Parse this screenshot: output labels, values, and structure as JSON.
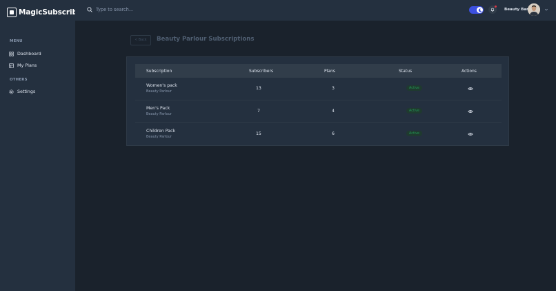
{
  "app": {
    "name": "MagicSubscribe",
    "logo_icon": "logo-square-icon"
  },
  "sidebar": {
    "groups": [
      {
        "title": "MENU",
        "items": [
          {
            "label": "Dashboard",
            "icon": "grid-icon"
          },
          {
            "label": "My Plans",
            "icon": "table-icon"
          }
        ]
      },
      {
        "title": "OTHERS",
        "items": [
          {
            "label": "Settings",
            "icon": "gear-icon"
          }
        ]
      }
    ]
  },
  "header": {
    "search_placeholder": "Type to search...",
    "user_name": "Beauty Bar",
    "theme_toggle": "dark",
    "notification": true
  },
  "page": {
    "back_label": "< Back",
    "title": "Beauty Parlour Subscriptions"
  },
  "table": {
    "columns": [
      "Subscription",
      "Subscribers",
      "Plans",
      "Status",
      "Actions"
    ],
    "rows": [
      {
        "name": "Women's pack",
        "category": "Beauty Parlour",
        "subscribers": "13",
        "plans": "3",
        "status": "Active"
      },
      {
        "name": "Men's Pack",
        "category": "Beauty Parlour",
        "subscribers": "7",
        "plans": "4",
        "status": "Active"
      },
      {
        "name": "Children Pack",
        "category": "Beauty Parlour",
        "subscribers": "15",
        "plans": "6",
        "status": "Active"
      }
    ]
  },
  "colors": {
    "sidebar_bg": "#24303f",
    "body_bg": "#1a222c",
    "accent": "#3c50e0",
    "success": "#219653",
    "notification_dot": "#dc3545"
  }
}
